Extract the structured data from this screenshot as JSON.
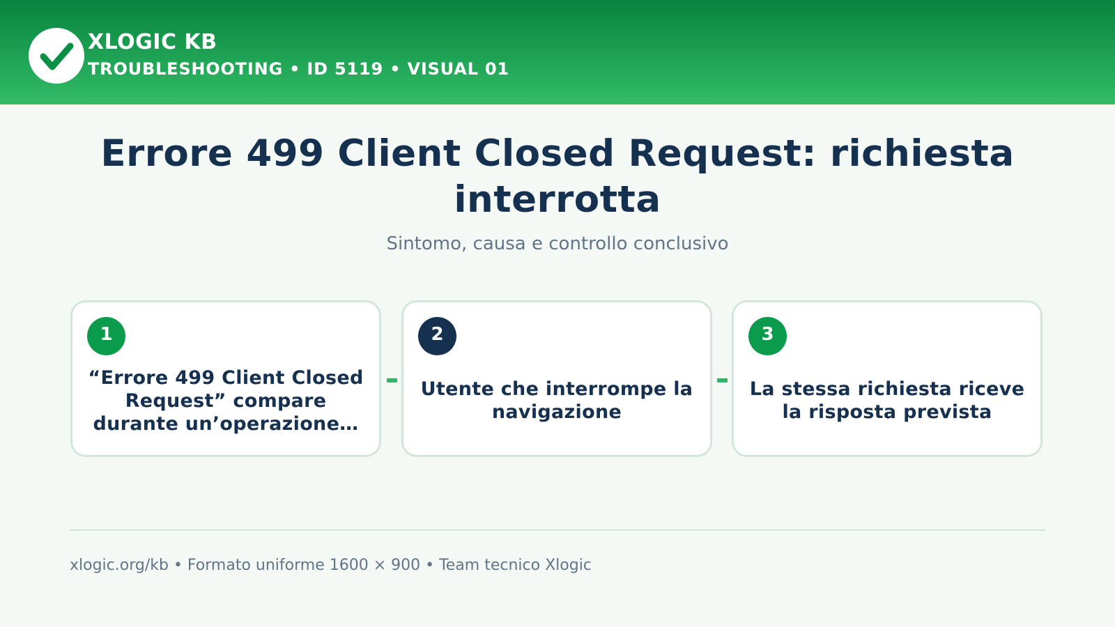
{
  "header": {
    "brand": "XLOGIC KB",
    "subtitle": "TROUBLESHOOTING • ID 5119 • VISUAL 01",
    "logo_icon": "checkmark-icon",
    "gradient_top": "#07843e",
    "gradient_bottom": "#33bb68"
  },
  "main": {
    "title": "Errore 499 Client Closed Request: richiesta interrotta",
    "subtitle": "Sintomo, causa e controllo conclusivo"
  },
  "steps": [
    {
      "number": "1",
      "text": "“Errore 499 Client Closed Request” compare durante un’operazione…",
      "badge_color": "#0a9b4c"
    },
    {
      "number": "2",
      "text": "Utente che interrompe la navigazione",
      "badge_color": "#16304f"
    },
    {
      "number": "3",
      "text": "La stessa richiesta riceve la risposta prevista",
      "badge_color": "#0a9b4c"
    }
  ],
  "footer": {
    "text": "xlogic.org/kb • Formato uniforme 1600 × 900 • Team tecnico Xlogic"
  },
  "colors": {
    "accent": "#2fb565",
    "navy": "#16304f",
    "background": "#f4f9f6"
  }
}
